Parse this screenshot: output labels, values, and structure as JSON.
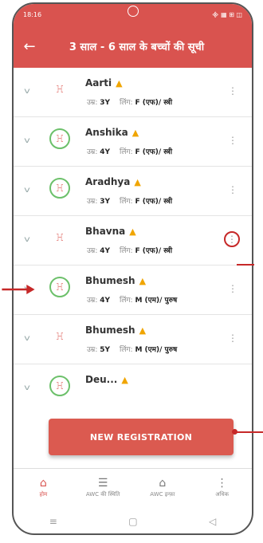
{
  "status": {
    "time": "18:16",
    "icons": "᯽ ▦ ⊞ ◫"
  },
  "header": {
    "back_icon": "←",
    "title": "3 साल - 6 साल के बच्चों की सूची"
  },
  "children": [
    {
      "name": "Aarti",
      "age_label": "उम्र:",
      "age": "3Y",
      "gender_label": "लिंग:",
      "gender": "F (एफ)/ स्त्री",
      "warn": true,
      "ring": false
    },
    {
      "name": "Anshika",
      "age_label": "उम्र:",
      "age": "4Y",
      "gender_label": "लिंग:",
      "gender": "F (एफ)/ स्त्री",
      "warn": true,
      "ring": true
    },
    {
      "name": "Aradhya",
      "age_label": "उम्र:",
      "age": "3Y",
      "gender_label": "लिंग:",
      "gender": "F (एफ)/ स्त्री",
      "warn": true,
      "ring": true
    },
    {
      "name": "Bhavna",
      "age_label": "उम्र:",
      "age": "4Y",
      "gender_label": "लिंग:",
      "gender": "F (एफ)/ स्त्री",
      "warn": true,
      "ring": false
    },
    {
      "name": "Bhumesh",
      "age_label": "उम्र:",
      "age": "4Y",
      "gender_label": "लिंग:",
      "gender": "M (एम)/ पुरुष",
      "warn": true,
      "ring": true
    },
    {
      "name": "Bhumesh",
      "age_label": "उम्र:",
      "age": "5Y",
      "gender_label": "लिंग:",
      "gender": "M (एम)/ पुरुष",
      "warn": true,
      "ring": false
    },
    {
      "name": "Deu...",
      "age_label": "",
      "age": "",
      "gender_label": "",
      "gender": "",
      "warn": true,
      "ring": true
    }
  ],
  "register_button": "NEW REGISTRATION",
  "tabs": [
    {
      "label": "होम",
      "icon": "home-icon"
    },
    {
      "label": "AWC की स्थिति",
      "icon": "list-icon"
    },
    {
      "label": "AWC इन्फ़ा",
      "icon": "building-icon"
    },
    {
      "label": "अधिक",
      "icon": "more-icon"
    }
  ],
  "colors": {
    "primary": "#d9534f",
    "pointer": "#c62828",
    "warning": "#f0a500",
    "green_ring": "#6cc06a"
  }
}
